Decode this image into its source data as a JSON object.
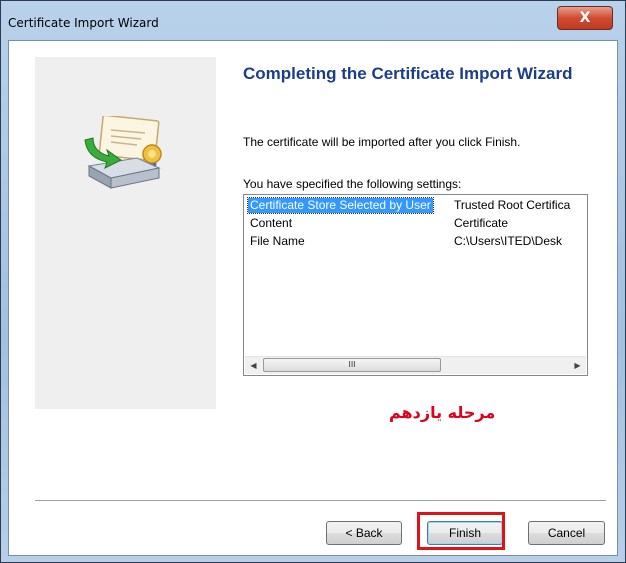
{
  "window": {
    "title": "Certificate Import Wizard",
    "close_symbol": "X"
  },
  "main": {
    "heading": "Completing the Certificate Import Wizard",
    "subtext": "The certificate will be imported after you click Finish.",
    "settings_label": "You have specified the following settings:",
    "settings": [
      {
        "key": "Certificate Store Selected by User",
        "value": "Trusted Root Certifica",
        "selected": true
      },
      {
        "key": "Content",
        "value": "Certificate",
        "selected": false
      },
      {
        "key": "File Name",
        "value": "C:\\Users\\ITED\\Desk",
        "selected": false
      }
    ],
    "scroll_grip": "III"
  },
  "annotation": "مرحله یازدهم",
  "buttons": {
    "back": "< Back",
    "finish": "Finish",
    "cancel": "Cancel"
  },
  "colors": {
    "heading": "#1a3e8c",
    "selection": "#3399ff",
    "annotation": "#e0001b",
    "highlight": "#e0111b"
  },
  "icons": {
    "wizard_graphic": "certificate-install-icon",
    "close": "close-icon",
    "scroll_left": "chevron-left-icon",
    "scroll_right": "chevron-right-icon"
  }
}
